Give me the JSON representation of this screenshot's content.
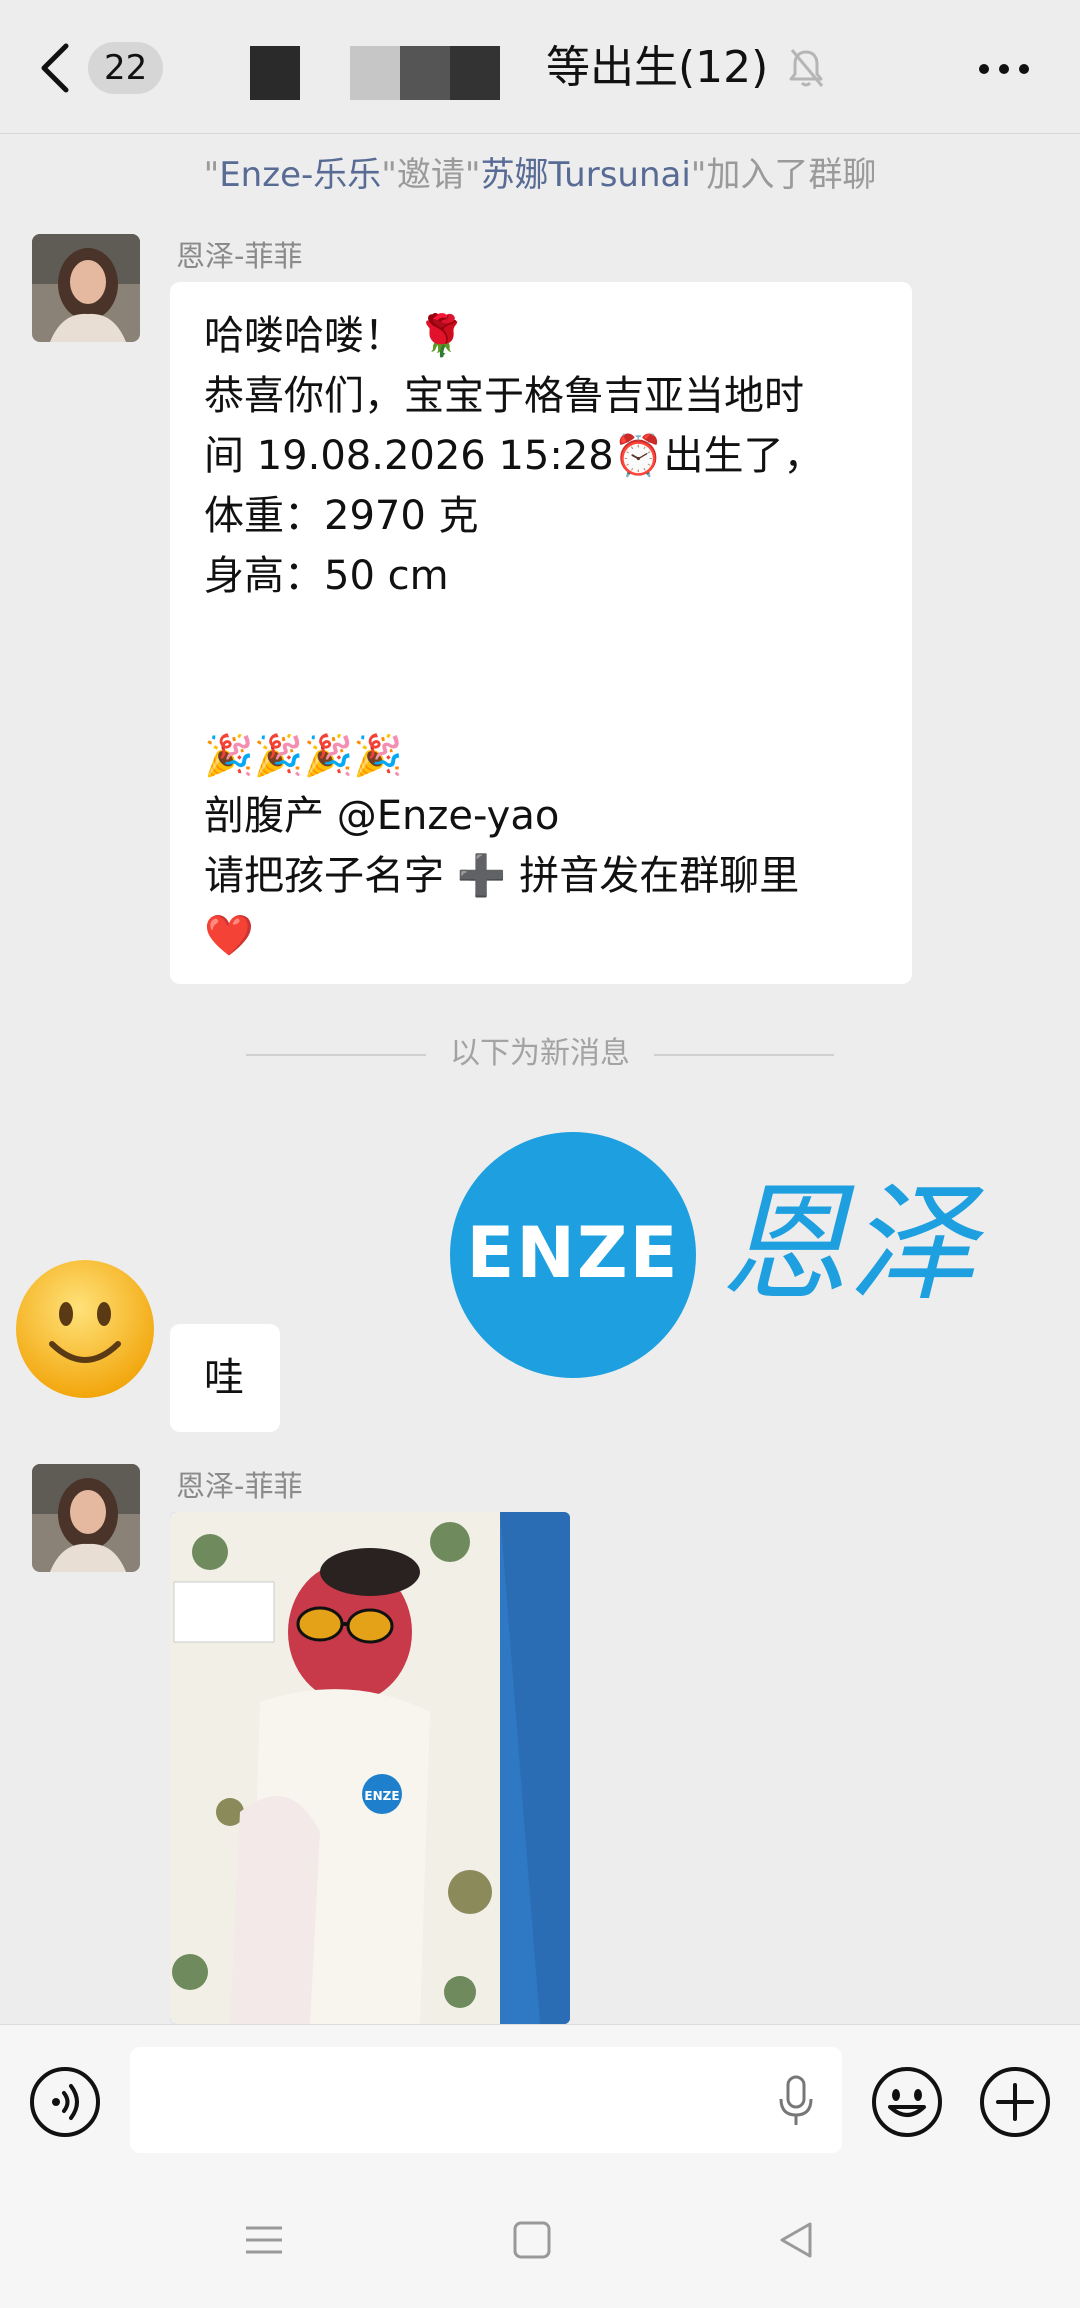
{
  "header": {
    "unread_count": "22",
    "title": "等出生(12)"
  },
  "system_notice": {
    "quote1": "\"",
    "inviter": "Enze-乐乐",
    "quote2": "\"邀请\"",
    "invitee": "苏娜Tursunai",
    "suffix": "\"加入了群聊"
  },
  "messages": [
    {
      "sender": "恩泽-菲菲",
      "lines": [
        "哈喽哈喽！ 🌹",
        "恭喜你们，宝宝于格鲁吉亚当地时",
        "间 19.08.2026 15:28⏰出生了，",
        "体重：2970 克",
        "身高：50 cm",
        "",
        "",
        "🎉🎉🎉🎉",
        "剖腹产 @Enze-yao",
        "请把孩子名字 ➕ 拼音发在群聊里",
        "❤️"
      ]
    },
    {
      "sender": "",
      "text": "哇"
    },
    {
      "sender": "恩泽-菲菲",
      "image": "newborn-photo"
    }
  ],
  "divider": "以下为新消息",
  "watermark": {
    "logo_text": "ENZE",
    "logo_cn": "恩泽"
  },
  "icons": {
    "back": "chevron-left-icon",
    "mute": "bell-off-icon",
    "more": "more-icon",
    "voice": "voice-icon",
    "mic": "mic-icon",
    "emoji": "emoji-icon",
    "plus": "plus-icon"
  },
  "colors": {
    "background": "#ededed",
    "link": "#576b95",
    "brand": "#1ea0e0"
  }
}
